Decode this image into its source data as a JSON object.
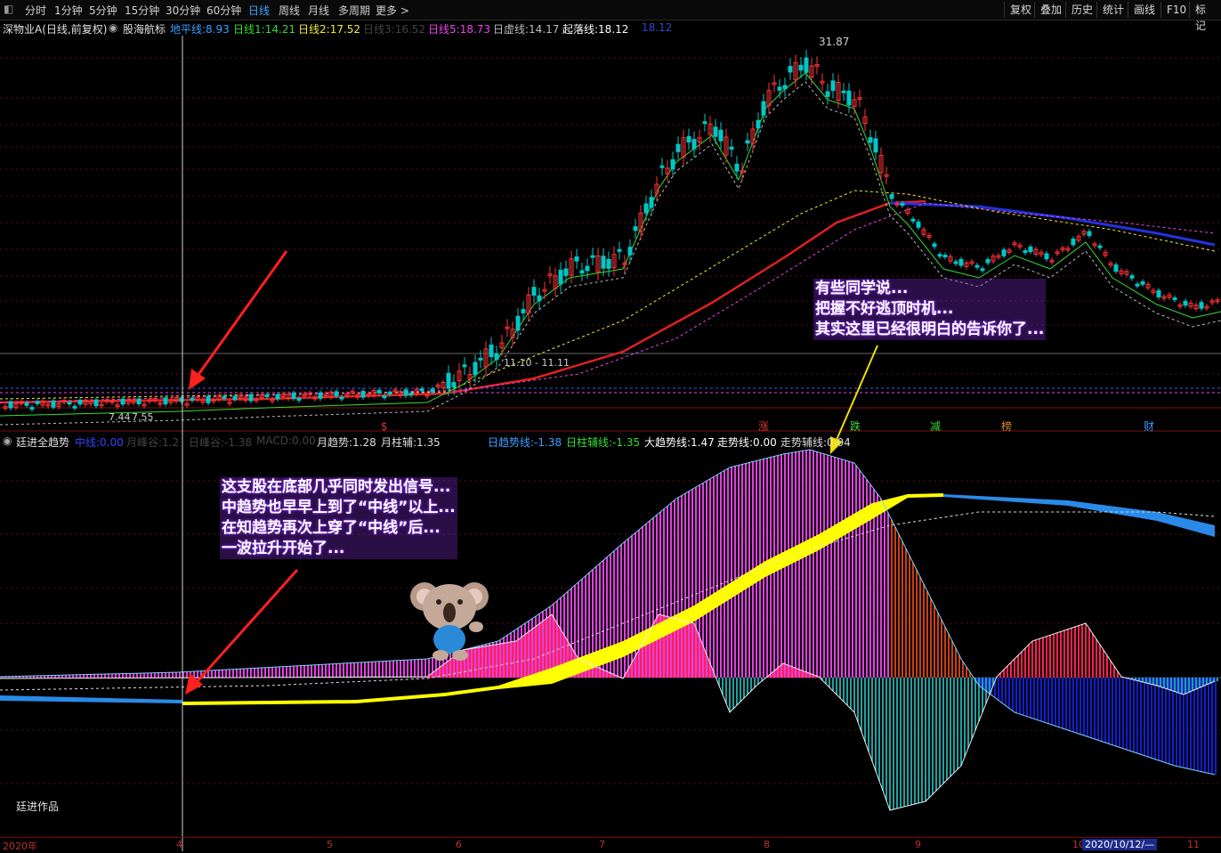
{
  "toolbar": {
    "periods": [
      "分时",
      "1分钟",
      "5分钟",
      "15分钟",
      "30分钟",
      "60分钟",
      "日线",
      "周线",
      "月线",
      "多周期",
      "更多 >"
    ],
    "active_period": "日线",
    "right_buttons": [
      "复权",
      "叠加",
      "历史",
      "统计",
      "画线",
      "F10",
      "标记"
    ]
  },
  "price_bar": {
    "stock_title": "深物业A(日线,前复权)",
    "indicator_name": "股海航标",
    "items": [
      {
        "label": "地平线:",
        "value": "8.93",
        "color": "#3aa0ff"
      },
      {
        "label": "日线1:",
        "value": "14.21",
        "color": "#33dd33"
      },
      {
        "label": "日线2:",
        "value": "17.52",
        "color": "#eeee33"
      },
      {
        "label": "日线3:",
        "value": "16.52",
        "color": "#444444"
      },
      {
        "label": "日线5:",
        "value": "18.73",
        "color": "#ee44ee"
      },
      {
        "label": "日虚线:",
        "value": "14.17",
        "color": "#bbbbbb"
      },
      {
        "label": "起落线:",
        "value": "18.12",
        "color": "#ffffff"
      },
      {
        "label": "",
        "value": "18.12",
        "color": "#3344cc"
      }
    ]
  },
  "price_chart": {
    "high_label": "31.87",
    "low_label": "7.44",
    "low_label2": "7.55",
    "range_label": "11.10 - 11.11",
    "event_markers": [
      {
        "text": "$",
        "color": "#dd3333"
      },
      {
        "text": "涨",
        "color": "#dd3333"
      },
      {
        "text": "跌",
        "color": "#33dd33"
      },
      {
        "text": "减",
        "color": "#33dd33"
      },
      {
        "text": "榜",
        "color": "#dd8833"
      },
      {
        "text": "财",
        "color": "#3399ff"
      }
    ]
  },
  "indicator_bar": {
    "name": "廷进全趋势",
    "items": [
      {
        "label": "中线:",
        "value": "0.00",
        "color": "#3344ff"
      },
      {
        "label": "月峰谷:",
        "value": "1.2",
        "color": "#444444"
      },
      {
        "label": "日峰谷:",
        "value": "-1.38",
        "color": "#444444"
      },
      {
        "label": "MACD:",
        "value": "0.00",
        "color": "#444444"
      },
      {
        "label": "月趋势:",
        "value": "1.28",
        "color": "#dddddd"
      },
      {
        "label": "月柱辅:",
        "value": "1.35",
        "color": "#dddddd"
      },
      {
        "label": "日趋势线:",
        "value": "-1.38",
        "color": "#3aa0ff"
      },
      {
        "label": "日柱辅线:",
        "value": "-1.35",
        "color": "#33dd33"
      },
      {
        "label": "大趋势线:",
        "value": "1.47",
        "color": "#ffffff"
      },
      {
        "label": "走势线:",
        "value": "0.00",
        "color": "#ffffff"
      },
      {
        "label": "走势辅线:",
        "value": "0.04",
        "color": "#dddddd"
      }
    ]
  },
  "annotations": {
    "top_right": [
      "有些同学说...",
      "把握不好逃顶时机...",
      "其实这里已经很明白的告诉你了..."
    ],
    "bottom_left": [
      "这支股在底部几乎同时发出信号...",
      "中趋势也早早上到了“中线”以上...",
      "在知趋势再次上穿了“中线”后...",
      "一波拉升开始了..."
    ],
    "author": "廷进作品"
  },
  "xaxis": {
    "labels": [
      "2020年",
      "4",
      "5",
      "6",
      "7",
      "8",
      "9",
      "10",
      "11"
    ],
    "cursor_date": "2020/10/12/—"
  },
  "colors": {
    "up": "#ff3333",
    "down": "#00c8c8",
    "arrow": "#ff2020",
    "arrow_yellow": "#f0e000",
    "ma_red": "#e02020",
    "ma_blue": "#2233dd",
    "band_yellow": "#ffff00",
    "hist_magenta": "#e040e0",
    "hist_red": "#ff2050",
    "hist_blue": "#1020d0",
    "hist_teal": "#20a0a0"
  }
}
